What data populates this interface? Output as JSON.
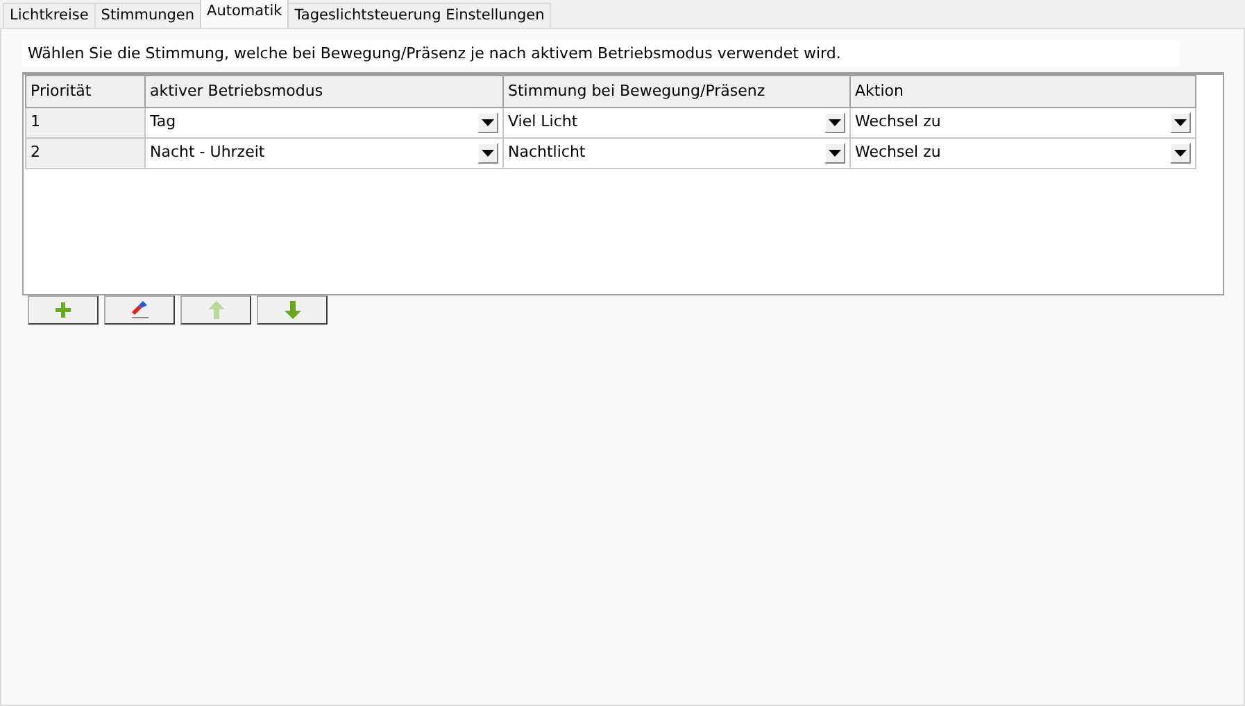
{
  "tabs": [
    {
      "label": "Lichtkreise",
      "selected": false
    },
    {
      "label": "Stimmungen",
      "selected": false
    },
    {
      "label": "Automatik",
      "selected": true
    },
    {
      "label": "Tageslichtsteuerung Einstellungen",
      "selected": false
    }
  ],
  "instruction": "Wählen Sie die Stimmung, welche bei Bewegung/Präsenz je nach aktivem Betriebsmodus verwendet wird.",
  "table": {
    "columns": [
      "Priorität",
      "aktiver Betriebsmodus",
      "Stimmung bei Bewegung/Präsenz",
      "Aktion"
    ],
    "rows": [
      [
        "1",
        "Tag",
        "Viel Licht",
        "Wechsel zu"
      ],
      [
        "2",
        "Nacht - Uhrzeit",
        "Nachtlicht",
        "Wechsel zu"
      ]
    ]
  },
  "buttons": [
    {
      "kind": "add",
      "disabled": false
    },
    {
      "kind": "erase",
      "disabled": false
    },
    {
      "kind": "up",
      "disabled": true
    },
    {
      "kind": "down",
      "disabled": false
    }
  ]
}
